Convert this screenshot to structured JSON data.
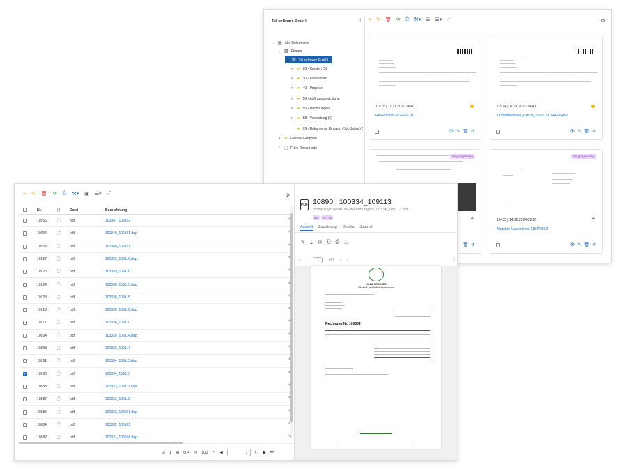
{
  "back_window": {
    "tree_title": "Tsl software GmbH",
    "tree": [
      {
        "label": "Alle Dokumente",
        "level": 0,
        "icon": "archive-icon"
      },
      {
        "label": "Firmen",
        "level": 1,
        "icon": "building-icon"
      },
      {
        "label": "Tsl software GmbH",
        "level": 2,
        "icon": "building-icon",
        "selected": true
      },
      {
        "label": "20 - Kunden (3)",
        "level": 3,
        "icon": "folder-icon"
      },
      {
        "label": "30 - Lieferanten",
        "level": 3,
        "icon": "folder-icon"
      },
      {
        "label": "40 - Projekte",
        "level": 3,
        "icon": "folder-icon"
      },
      {
        "label": "50 - Auftragsabwicklung",
        "level": 3,
        "icon": "folder-icon"
      },
      {
        "label": "55 - Rechnungen",
        "level": 3,
        "icon": "folder-icon"
      },
      {
        "label": "88 - Verwaltung (5)",
        "level": 3,
        "icon": "folder-icon"
      },
      {
        "label": "99 - Dokumente Eingang (\\\\dc-1\\dms) (",
        "level": 3,
        "icon": "folder-icon"
      },
      {
        "label": "Globale Gruppen",
        "level": 1,
        "icon": "folder-icon"
      },
      {
        "label": "Freie Dokumente",
        "level": 1,
        "icon": "document-icon"
      }
    ],
    "cards": [
      {
        "caption": "10175 | 11.11.2021 14:40",
        "link": "Re-Nummer-2024-09-09",
        "status": "yellow"
      },
      {
        "caption": "10174 | 11.11.2021 14:40",
        "link": "Ticketabschluss_61819_20211111-144035492",
        "status": "yellow"
      },
      {
        "caption": "",
        "link": "",
        "tag": "Eingangsbeleg"
      },
      {
        "caption": "19435 | 14.10.2024 09:26",
        "link": "Angebot-Musterfirma-215478862",
        "tag": "Eingangsbeleg"
      }
    ]
  },
  "front_window": {
    "headers": {
      "nr": "Nr.",
      "datei": "Datei",
      "bezeichnung": "Bezeichnung"
    },
    "rows": [
      {
        "nr": "10956",
        "ext": "pdf",
        "name": "100341_109122",
        "checked": false
      },
      {
        "nr": "10954",
        "ext": "pdf",
        "name": "100340_109121.dup",
        "checked": false
      },
      {
        "nr": "10953",
        "ext": "pdf",
        "name": "100340_109121",
        "checked": false
      },
      {
        "nr": "10927",
        "ext": "pdf",
        "name": "100339_109116.dup",
        "checked": false
      },
      {
        "nr": "10926",
        "ext": "pdf",
        "name": "100339_109116",
        "checked": false
      },
      {
        "nr": "10924",
        "ext": "pdf",
        "name": "100338_109115.dup",
        "checked": false
      },
      {
        "nr": "10923",
        "ext": "pdf",
        "name": "100338_109115",
        "checked": false
      },
      {
        "nr": "10918",
        "ext": "pdf",
        "name": "100336_109110.dup",
        "checked": false
      },
      {
        "nr": "10917",
        "ext": "pdf",
        "name": "100336_109110",
        "checked": false
      },
      {
        "nr": "10894",
        "ext": "pdf",
        "name": "100335_109114.dup",
        "checked": false
      },
      {
        "nr": "10893",
        "ext": "pdf",
        "name": "100335_109114",
        "checked": false
      },
      {
        "nr": "10891",
        "ext": "pdf",
        "name": "100334_109113.dup",
        "checked": false
      },
      {
        "nr": "10890",
        "ext": "pdf",
        "name": "100334_109113",
        "checked": true
      },
      {
        "nr": "10888",
        "ext": "pdf",
        "name": "100333_109111.dup",
        "checked": false
      },
      {
        "nr": "10887",
        "ext": "pdf",
        "name": "100333_109111",
        "checked": false
      },
      {
        "nr": "10885",
        "ext": "pdf",
        "name": "100332_108991.dup",
        "checked": false
      },
      {
        "nr": "10884",
        "ext": "pdf",
        "name": "100332_108991",
        "checked": false
      },
      {
        "nr": "10882",
        "ext": "pdf",
        "name": "100331_108958.dup",
        "checked": false
      }
    ],
    "pager": {
      "selected": "1",
      "total": "604",
      "per_page": "100",
      "page": "1",
      "of": "/ 7"
    },
    "detail": {
      "title": "10890 | 100334_109113",
      "path": "/company.ruler/ACME/Rechnungen/100334_109113.pdf",
      "badges": [
        "pdf",
        "RE / 08"
      ],
      "tabs": [
        "Ansicht",
        "Zuordnung",
        "Details",
        "Journal"
      ],
      "viewer_page": "1",
      "viewer_of": "of 1",
      "doc": {
        "company": "HOME SERVICES",
        "tagline": "Repair & Installation Professional",
        "invoice": "Rechnung Nr. 100334"
      }
    }
  }
}
